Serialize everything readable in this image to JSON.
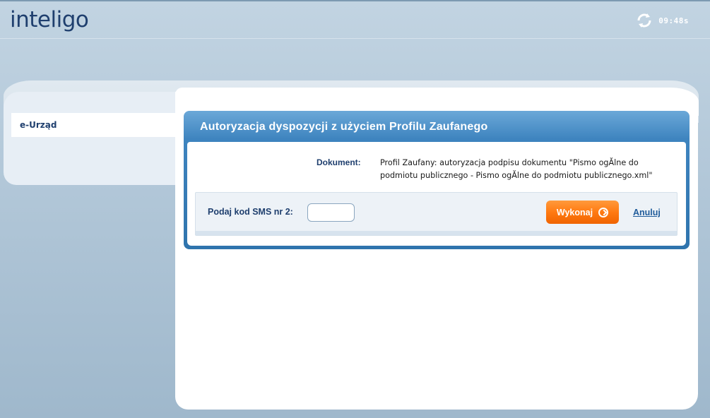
{
  "header": {
    "logo_text": "inteligo",
    "session_time": "09:48s"
  },
  "sidebar": {
    "items": [
      {
        "label": "e-Urząd"
      }
    ]
  },
  "dialog": {
    "title": "Autoryzacja dyspozycji z użyciem Profilu Zaufanego",
    "document_label": "Dokument:",
    "document_value": "Profil Zaufany: autoryzacja podpisu dokumentu \"Pismo ogĂlne do podmiotu publicznego - Pismo ogĂlne do podmiotu publicznego.xml\"",
    "sms_label": "Podaj kod SMS nr 2:",
    "sms_value": "",
    "sms_placeholder": "",
    "execute_label": "Wykonaj",
    "cancel_label": "Anuluj"
  },
  "colors": {
    "accent": "#ff7a12",
    "brand": "#1f3f6e",
    "dialog_header": "#3e84bf"
  },
  "icons": [
    "refresh-icon",
    "arrow-right-circle-icon"
  ]
}
